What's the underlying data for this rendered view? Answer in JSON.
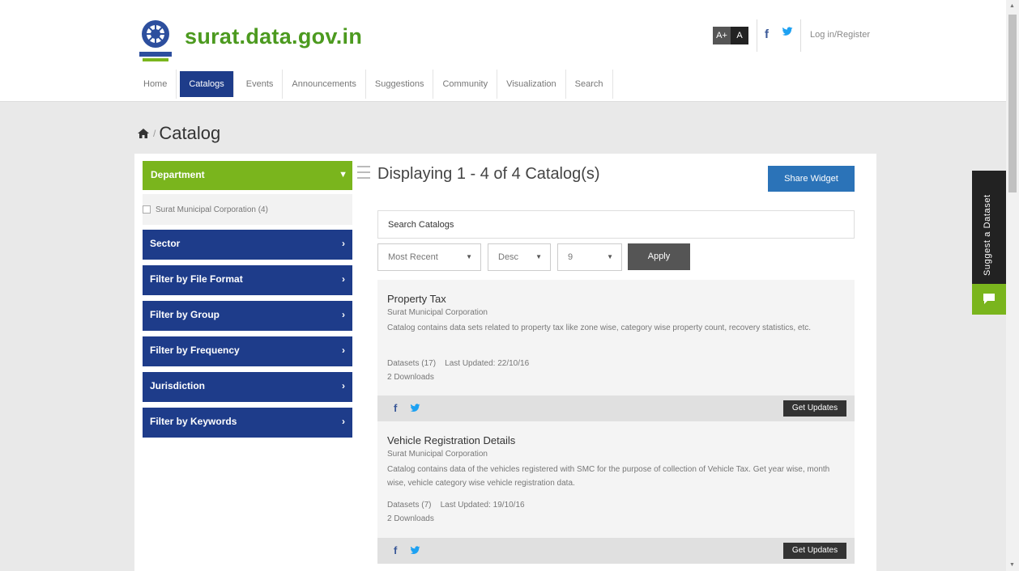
{
  "header": {
    "site_title": "surat.data.gov.in",
    "font_large": "A+",
    "font_small": "A",
    "login_label": "Log in/Register"
  },
  "nav": {
    "items": [
      {
        "label": "Home",
        "active": false
      },
      {
        "label": "Catalogs",
        "active": true
      },
      {
        "label": "Events",
        "active": false
      },
      {
        "label": "Announcements",
        "active": false
      },
      {
        "label": "Suggestions",
        "active": false
      },
      {
        "label": "Community",
        "active": false
      },
      {
        "label": "Visualization",
        "active": false
      },
      {
        "label": "Search",
        "active": false
      }
    ]
  },
  "breadcrumb": {
    "separator": "/",
    "title": "Catalog"
  },
  "sidebar": {
    "department": {
      "label": "Department",
      "option": "Surat Municipal Corporation (4)"
    },
    "filters": [
      {
        "label": "Sector"
      },
      {
        "label": "Filter by File Format"
      },
      {
        "label": "Filter by Group"
      },
      {
        "label": "Filter by Frequency"
      },
      {
        "label": "Jurisdiction"
      },
      {
        "label": "Filter by Keywords"
      }
    ]
  },
  "main": {
    "display_title": "Displaying 1 - 4 of 4 Catalog(s)",
    "share_label": "Share Widget",
    "search_placeholder": "Search Catalogs",
    "sort_by": "Most Recent",
    "sort_order": "Desc",
    "per_page": "9",
    "apply_label": "Apply",
    "get_updates_label": "Get Updates",
    "catalogs": [
      {
        "title": "Property Tax",
        "org": "Surat Municipal Corporation",
        "description": "Catalog contains data sets related to property tax like zone wise, category wise property count, recovery statistics, etc.",
        "datasets": "Datasets (17)",
        "updated": "Last Updated: 22/10/16",
        "downloads": "2 Downloads"
      },
      {
        "title": "Vehicle Registration Details",
        "org": "Surat Municipal Corporation",
        "description": "Catalog contains data of the vehicles registered with SMC for the purpose of collection of Vehicle Tax. Get year wise, month wise, vehicle category wise vehicle registration data.",
        "datasets": "Datasets (7)",
        "updated": "Last Updated: 19/10/16",
        "downloads": "2 Downloads"
      }
    ]
  },
  "side_tab": {
    "suggest_label": "Suggest a Dataset"
  },
  "colors": {
    "brand_green": "#7ab51d",
    "title_green": "#4c9a1f",
    "nav_blue": "#1e3c8a",
    "share_blue": "#2b73b8"
  }
}
